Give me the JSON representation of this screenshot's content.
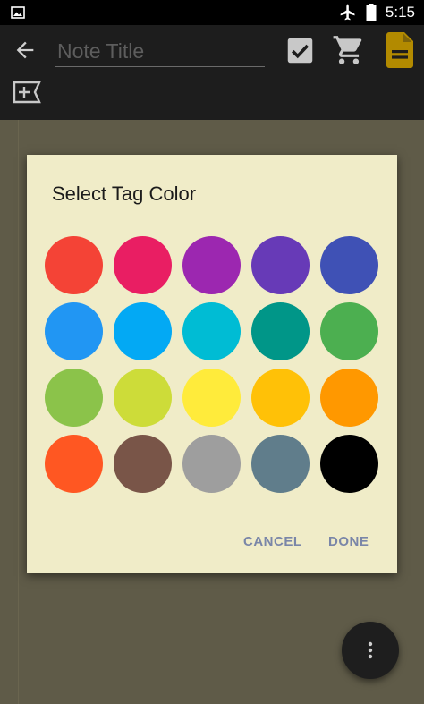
{
  "status_bar": {
    "time": "5:15",
    "icons": [
      "image-icon",
      "airplane-icon",
      "battery-icon"
    ]
  },
  "toolbar": {
    "title_placeholder": "Note Title",
    "title_value": "",
    "icons": [
      "back-arrow-icon",
      "checkbox-icon",
      "cart-icon",
      "note-icon",
      "add-tag-icon"
    ],
    "accent_color": "#b28a00"
  },
  "dialog": {
    "title": "Select Tag Color",
    "cancel_label": "CANCEL",
    "done_label": "DONE",
    "colors": [
      "#f44336",
      "#e91e63",
      "#9c27b0",
      "#673ab7",
      "#3f51b5",
      "#2196f3",
      "#03a9f4",
      "#00bcd4",
      "#009688",
      "#4caf50",
      "#8bc34a",
      "#cddc39",
      "#ffeb3b",
      "#ffc107",
      "#ff9800",
      "#ff5722",
      "#795548",
      "#9e9e9e",
      "#607d8b",
      "#000000"
    ]
  },
  "fab": {
    "icon": "more-vertical-icon"
  }
}
